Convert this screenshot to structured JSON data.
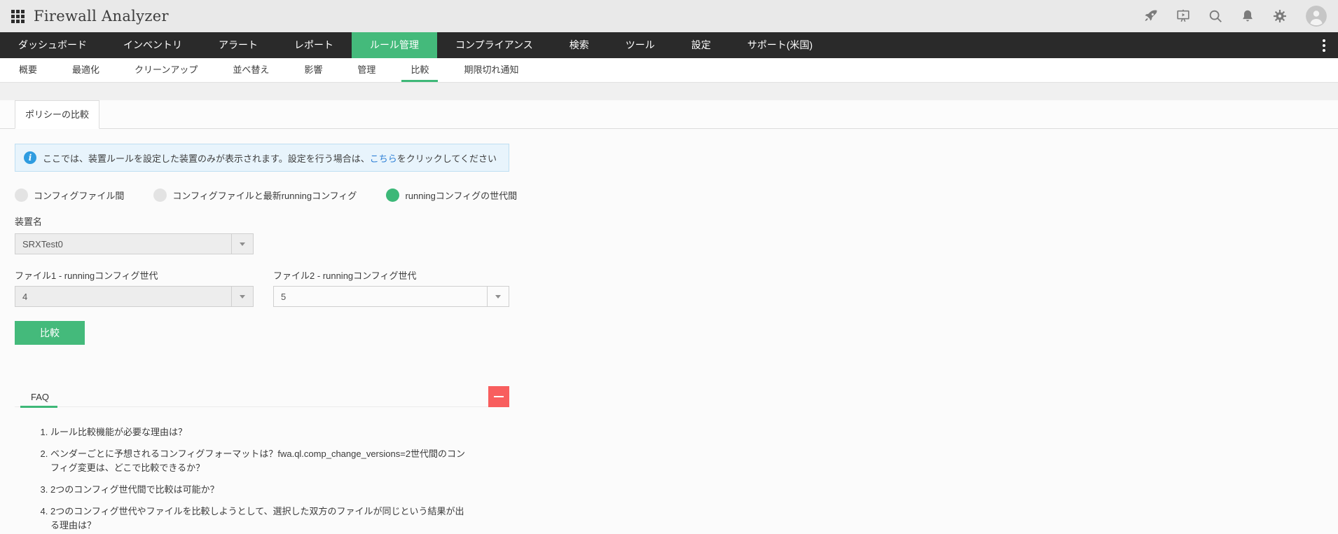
{
  "header": {
    "app_title": "Firewall Analyzer",
    "action_icons": [
      "launcher-rocket",
      "demo-player",
      "search",
      "notifications",
      "settings",
      "user-account"
    ]
  },
  "nav": {
    "items": [
      {
        "label": "ダッシュボード",
        "active": false
      },
      {
        "label": "インベントリ",
        "active": false
      },
      {
        "label": "アラート",
        "active": false
      },
      {
        "label": "レポート",
        "active": false
      },
      {
        "label": "ルール管理",
        "active": true
      },
      {
        "label": "コンプライアンス",
        "active": false
      },
      {
        "label": "検索",
        "active": false
      },
      {
        "label": "ツール",
        "active": false
      },
      {
        "label": "設定",
        "active": false
      },
      {
        "label": "サポート(米国)",
        "active": false
      }
    ]
  },
  "subnav": {
    "items": [
      {
        "label": "概要",
        "active": false
      },
      {
        "label": "最適化",
        "active": false
      },
      {
        "label": "クリーンアップ",
        "active": false
      },
      {
        "label": "並べ替え",
        "active": false
      },
      {
        "label": "影響",
        "active": false
      },
      {
        "label": "管理",
        "active": false
      },
      {
        "label": "比較",
        "active": true
      },
      {
        "label": "期限切れ通知",
        "active": false
      }
    ]
  },
  "content": {
    "tab_title": "ポリシーの比較",
    "info_banner": {
      "text": "ここでは、装置ルールを設定した装置のみが表示されます。設定を行う場合は、",
      "link_text": "こちら",
      "text_suffix": "をクリックしてください"
    },
    "compare_modes": [
      {
        "label": "コンフィグファイル間",
        "selected": false
      },
      {
        "label": "コンフィグファイルと最新runningコンフィグ",
        "selected": false
      },
      {
        "label": "runningコンフィグの世代間",
        "selected": true
      }
    ],
    "device_field": {
      "label": "装置名",
      "value": "SRXTest0"
    },
    "file1_field": {
      "label": "ファイル1 - runningコンフィグ世代",
      "value": "4"
    },
    "file2_field": {
      "label": "ファイル2 - runningコンフィグ世代",
      "value": "5"
    },
    "compare_button_label": "比較",
    "faq": {
      "title": "FAQ",
      "items": [
        "ルール比較機能が必要な理由は？",
        "ベンダーごとに予想されるコンフィグフォーマットは？fwa.ql.comp_change_versions=2世代間のコンフィグ変更は、どこで比較できるか？",
        "2つのコンフィグ世代間で比較は可能か？",
        "2つのコンフィグ世代やファイルを比較しようとして、選択した双方のファイルが同じという結果が出る理由は？"
      ]
    }
  },
  "colors": {
    "accent_green": "#44ba7b",
    "nav_bg": "#2a2a2a",
    "danger_red": "#f85e5e",
    "info_blue": "#2f9ce0",
    "link_blue": "#2e80d6"
  }
}
